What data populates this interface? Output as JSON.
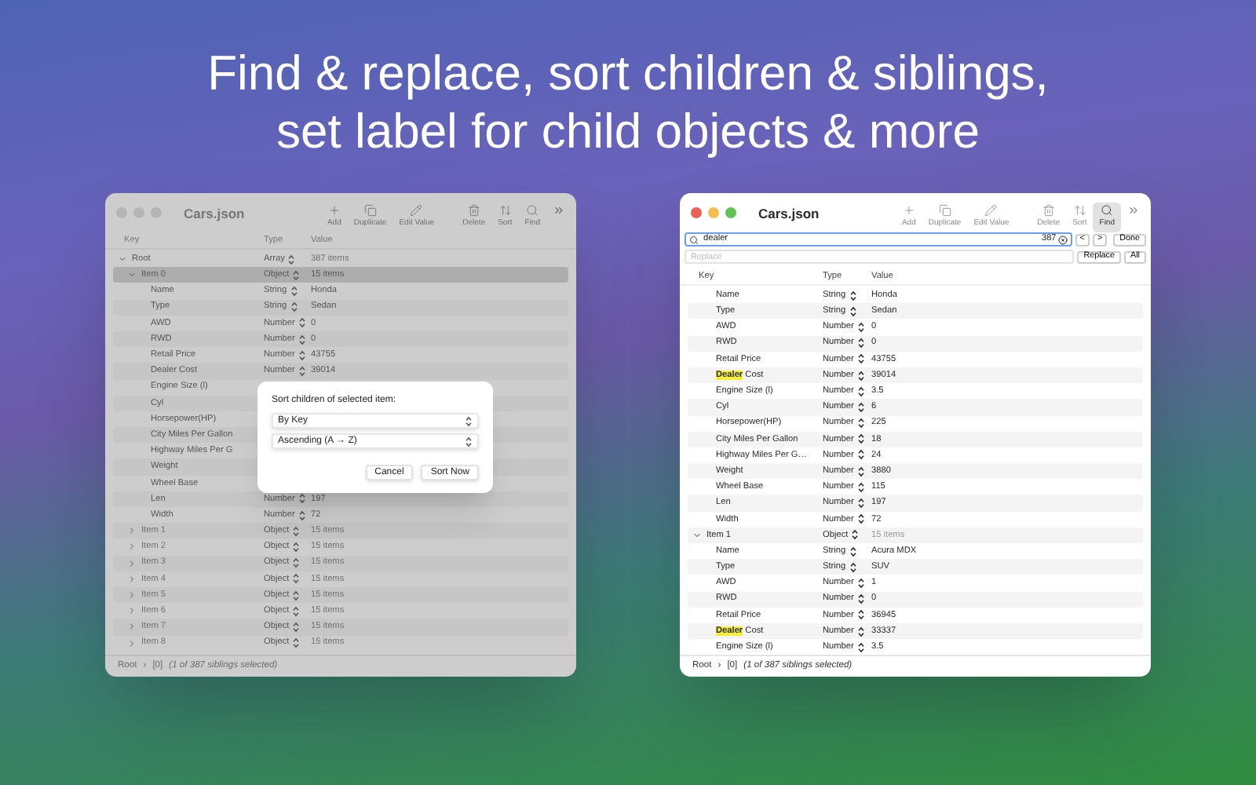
{
  "headline": [
    "Find & replace, sort children & siblings,",
    "set label for child objects & more"
  ],
  "windows": [
    {
      "title": "Cars.json",
      "dimmed": true,
      "toolbar": [
        {
          "kind": "add",
          "label": "Add",
          "selected": false
        },
        {
          "kind": "duplicate",
          "label": "Duplicate",
          "selected": false
        },
        {
          "kind": "edit",
          "label": "Edit Value",
          "selected": false
        },
        {
          "kind": "delete",
          "label": "Delete",
          "selected": false
        },
        {
          "kind": "sort",
          "label": "Sort",
          "selected": false
        },
        {
          "kind": "find",
          "label": "Find",
          "selected": false
        }
      ],
      "columns": [
        "Key",
        "Type",
        "Value"
      ],
      "tree": [
        {
          "key": "Root",
          "type": "Array",
          "value": "387 items",
          "expanded": true,
          "selected": false,
          "children": [
            {
              "key": "Item 0",
              "type": "Object",
              "value": "15 items",
              "expanded": true,
              "selected": true,
              "children": [
                {
                  "key": "Name",
                  "type": "String",
                  "value": "Honda",
                  "selected": false
                },
                {
                  "key": "Type",
                  "type": "String",
                  "value": "Sedan",
                  "selected": false
                },
                {
                  "key": "AWD",
                  "type": "Number",
                  "value": "0",
                  "selected": false
                },
                {
                  "key": "RWD",
                  "type": "Number",
                  "value": "0",
                  "selected": false
                },
                {
                  "key": "Retail Price",
                  "type": "Number",
                  "value": "43755",
                  "selected": false
                },
                {
                  "key": "Dealer Cost",
                  "type": "Number",
                  "value": "39014",
                  "selected": false
                },
                {
                  "key": "Engine Size (l)",
                  "selected": false
                },
                {
                  "key": "Cyl",
                  "selected": false
                },
                {
                  "key": "Horsepower(HP)",
                  "selected": false
                },
                {
                  "key": "City Miles Per Gallon",
                  "selected": false
                },
                {
                  "key": "Highway Miles Per G",
                  "selected": false
                },
                {
                  "key": "Weight",
                  "selected": false
                },
                {
                  "key": "Wheel Base",
                  "selected": false
                },
                {
                  "key": "Len",
                  "type": "Number",
                  "value": "197",
                  "selected": false
                },
                {
                  "key": "Width",
                  "type": "Number",
                  "value": "72",
                  "selected": false
                }
              ]
            },
            {
              "key": "Item 1",
              "type": "Object",
              "value": "15 items",
              "expanded": false,
              "selected": false
            },
            {
              "key": "Item 2",
              "type": "Object",
              "value": "15 items",
              "expanded": false,
              "selected": false
            },
            {
              "key": "Item 3",
              "type": "Object",
              "value": "15 items",
              "expanded": false,
              "selected": false
            },
            {
              "key": "Item 4",
              "type": "Object",
              "value": "15 items",
              "expanded": false,
              "selected": false
            },
            {
              "key": "Item 5",
              "type": "Object",
              "value": "15 items",
              "expanded": false,
              "selected": false
            },
            {
              "key": "Item 6",
              "type": "Object",
              "value": "15 items",
              "expanded": false,
              "selected": false
            },
            {
              "key": "Item 7",
              "type": "Object",
              "value": "15 items",
              "expanded": false,
              "selected": false
            },
            {
              "key": "Item 8",
              "type": "Object",
              "value": "15 items",
              "expanded": false,
              "selected": false
            }
          ]
        }
      ],
      "status": {
        "root": "Root",
        "separator": "›",
        "path": "[0]",
        "note": "(1 of 387 siblings selected)"
      },
      "dialog": {
        "title": "Sort children of selected item:",
        "selects": [
          "By Key",
          "Ascending (A → Z)"
        ],
        "buttons": [
          "Cancel",
          "Sort Now"
        ]
      }
    },
    {
      "title": "Cars.json",
      "dimmed": false,
      "toolbar": [
        {
          "kind": "add",
          "label": "Add",
          "selected": false
        },
        {
          "kind": "duplicate",
          "label": "Duplicate",
          "selected": false
        },
        {
          "kind": "edit",
          "label": "Edit Value",
          "selected": false
        },
        {
          "kind": "delete",
          "label": "Delete",
          "selected": false
        },
        {
          "kind": "sort",
          "label": "Sort",
          "selected": false
        },
        {
          "kind": "find",
          "label": "Find",
          "selected": true
        }
      ],
      "find": {
        "value": "dealer",
        "count": "387",
        "prev": "<",
        "next": ">",
        "done": "Done",
        "replace_placeholder": "Replace",
        "replace": "Replace",
        "all": "All"
      },
      "columns": [
        "Key",
        "Type",
        "Value"
      ],
      "tree": [
        {
          "children": [
            {
              "key": "Name",
              "type": "String",
              "value": "Honda",
              "selected": false
            },
            {
              "key": "Type",
              "type": "String",
              "value": "Sedan",
              "selected": false
            },
            {
              "key": "AWD",
              "type": "Number",
              "value": "0",
              "selected": false
            },
            {
              "key": "RWD",
              "type": "Number",
              "value": "0",
              "selected": false
            },
            {
              "key": "Retail Price",
              "type": "Number",
              "value": "43755",
              "selected": false
            },
            {
              "key_parts": [
                {
                  "text": "Dealer",
                  "match": true
                },
                {
                  "text": " Cost",
                  "match": false
                }
              ],
              "type": "Number",
              "value": "39014",
              "selected": false
            },
            {
              "key": "Engine Size (l)",
              "type": "Number",
              "value": "3.5",
              "selected": false
            },
            {
              "key": "Cyl",
              "type": "Number",
              "value": "6",
              "selected": false
            },
            {
              "key": "Horsepower(HP)",
              "type": "Number",
              "value": "225",
              "selected": false
            },
            {
              "key": "City Miles Per Gallon",
              "type": "Number",
              "value": "18",
              "selected": false
            },
            {
              "key": "Highway Miles Per G…",
              "type": "Number",
              "value": "24",
              "selected": false
            },
            {
              "key": "Weight",
              "type": "Number",
              "value": "3880",
              "selected": false
            },
            {
              "key": "Wheel Base",
              "type": "Number",
              "value": "115",
              "selected": false
            },
            {
              "key": "Len",
              "type": "Number",
              "value": "197",
              "selected": false
            },
            {
              "key": "Width",
              "type": "Number",
              "value": "72",
              "selected": false
            }
          ]
        },
        {
          "key": "Item 1",
          "type": "Object",
          "value": "15 items",
          "expanded": true,
          "selected": false,
          "children": [
            {
              "key": "Name",
              "type": "String",
              "value": "Acura MDX",
              "selected": false
            },
            {
              "key": "Type",
              "type": "String",
              "value": "SUV",
              "selected": false
            },
            {
              "key": "AWD",
              "type": "Number",
              "value": "1",
              "selected": false
            },
            {
              "key": "RWD",
              "type": "Number",
              "value": "0",
              "selected": false
            },
            {
              "key": "Retail Price",
              "type": "Number",
              "value": "36945",
              "selected": false
            },
            {
              "key_parts": [
                {
                  "text": "Dealer",
                  "match": true
                },
                {
                  "text": " Cost",
                  "match": false
                }
              ],
              "type": "Number",
              "value": "33337",
              "selected": false
            },
            {
              "key": "Engine Size (l)",
              "type": "Number",
              "value": "3.5",
              "selected": false
            }
          ]
        }
      ],
      "status": {
        "root": "Root",
        "separator": "›",
        "path": "[0]",
        "note": "(1 of 387 siblings selected)"
      }
    }
  ]
}
